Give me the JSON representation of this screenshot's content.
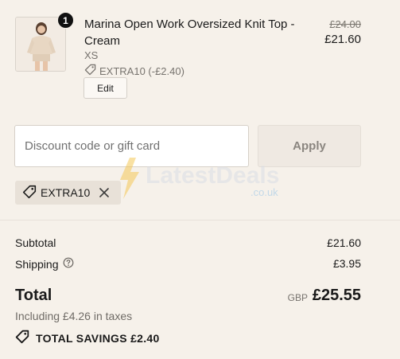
{
  "line_item": {
    "quantity": "1",
    "title": "Marina Open Work Oversized Knit Top - Cream",
    "variant": "XS",
    "discount_label": "EXTRA10 (-£2.40)",
    "edit_label": "Edit",
    "original_price": "£24.00",
    "price": "£21.60"
  },
  "discount_form": {
    "placeholder": "Discount code or gift card",
    "value": "",
    "apply_label": "Apply"
  },
  "applied_code": {
    "code": "EXTRA10"
  },
  "watermark": {
    "brand": "LatestDeals",
    "suffix": ".co.uk"
  },
  "summary": {
    "subtotal_label": "Subtotal",
    "subtotal_value": "£21.60",
    "shipping_label": "Shipping",
    "shipping_value": "£3.95",
    "total_label": "Total",
    "currency": "GBP",
    "total_value": "£25.55",
    "tax_note": "Including £4.26 in taxes",
    "savings_label": "TOTAL SAVINGS £2.40"
  },
  "colors": {
    "background": "#f6f1ea",
    "text": "#1a1a1a",
    "muted": "#77736e",
    "watermark_accent": "#f5c54a",
    "watermark_blue": "#4aa3e0"
  }
}
